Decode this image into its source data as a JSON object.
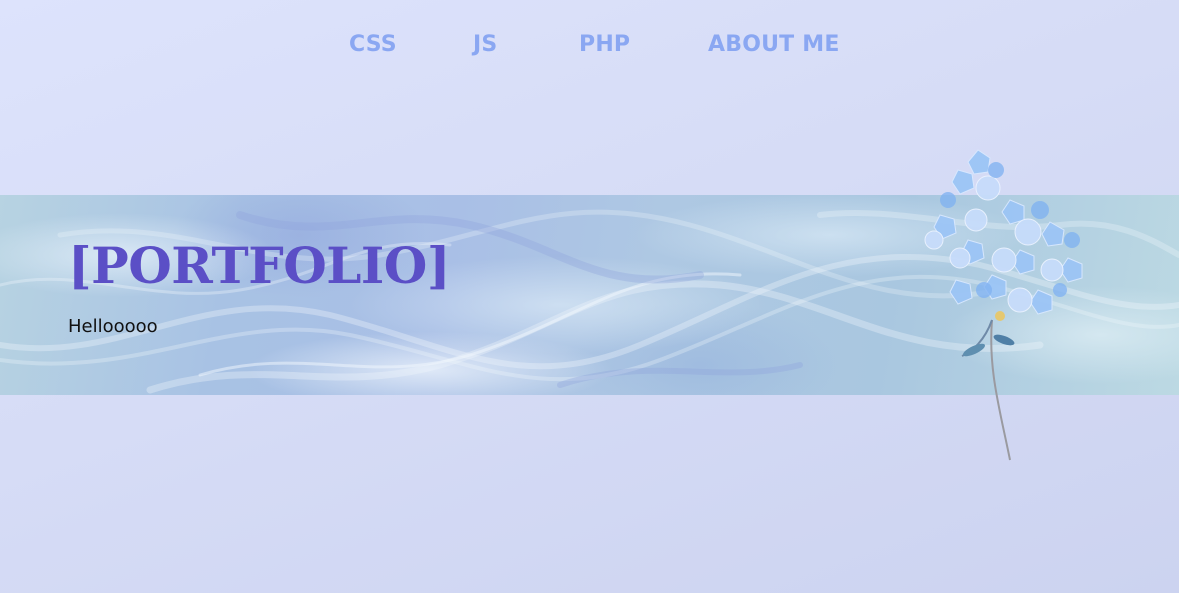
{
  "nav": {
    "items": [
      {
        "label": "CSS"
      },
      {
        "label": "JS"
      },
      {
        "label": "PHP"
      },
      {
        "label": "ABOUT ME"
      }
    ]
  },
  "hero": {
    "title": "[PORTFOLIO]",
    "subtitle": "Hellooooo"
  },
  "decor": {
    "image": "blue-flower-sprig",
    "colors": {
      "nav_link": "#8aa7f2",
      "title": "#5b4fc6",
      "page_bg": "#d8def8",
      "banner": "#aac4e2"
    }
  }
}
